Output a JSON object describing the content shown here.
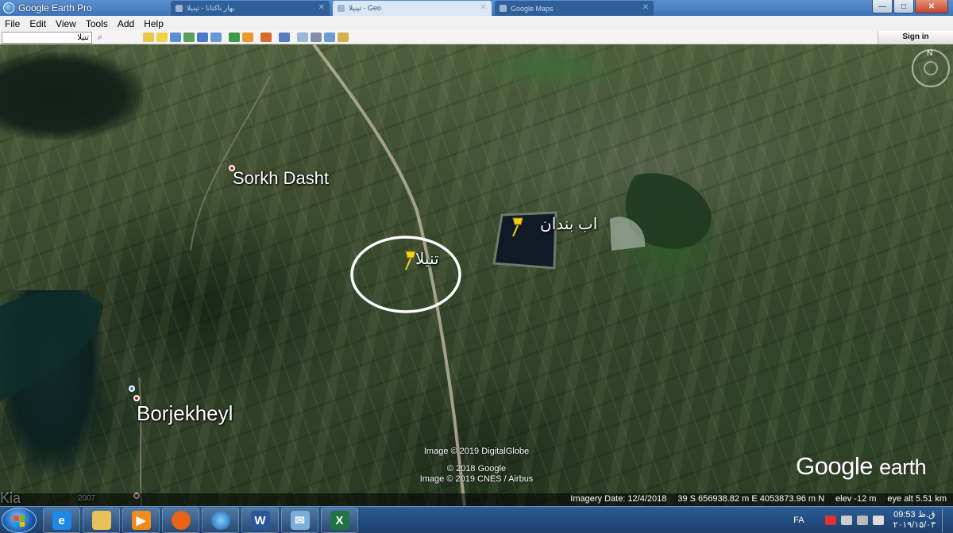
{
  "window": {
    "title": "Google Earth Pro",
    "tabs": [
      "بهار ناکتانا - تینیلا",
      "تینیلا - Geo",
      "Google Maps"
    ],
    "controls": {
      "minimize": "—",
      "maximize": "□",
      "close": "✕"
    }
  },
  "menu": {
    "items": [
      "File",
      "Edit",
      "View",
      "Tools",
      "Add",
      "Help"
    ]
  },
  "toolbar": {
    "search_value": "تنیلا",
    "sign_in_label": "Sign in",
    "icons": [
      "hide-sidebar-icon",
      "add-placemark-icon",
      "add-polygon-icon",
      "add-path-icon",
      "add-image-overlay-icon",
      "record-tour-icon",
      "historical-imagery-icon",
      "sunlight-icon",
      "switch-planet-icon",
      "ruler-icon",
      "email-icon",
      "print-icon",
      "save-image-icon",
      "view-in-maps-icon"
    ]
  },
  "map": {
    "labels": {
      "sorkh_dasht": "Sorkh Dasht",
      "borjekheyl": "Borjekheyl",
      "ab_bandan": "اب بندان",
      "tenela": "تنیلا",
      "year": "2007",
      "partial": "Kia"
    },
    "credits": [
      "Image © 2019 DigitalGlobe",
      "© 2018 Google",
      "Image © 2019 CNES / Airbus"
    ],
    "logo": {
      "google": "Google",
      "earth": "earth"
    },
    "compass_north": "N",
    "status": {
      "imagery_date": "Imagery Date: 12/4/2018",
      "coordinates": "39 S 656938.82 m E 4053873.96 m N",
      "elevation": "elev   -12 m",
      "eye_alt": "eye alt   5.51 km"
    }
  },
  "taskbar": {
    "apps": [
      "windows-media-player-icon",
      "internet-explorer-icon",
      "file-explorer-icon",
      "media-player-icon",
      "firefox-icon",
      "google-earth-icon",
      "word-icon",
      "outlook-icon",
      "excel-icon"
    ],
    "language": "FA",
    "clock_time": "09:53 ق.ظ",
    "clock_date": "۲۰۱۹/۱۵/۰۳"
  },
  "colors": {
    "titlebar": "#3f74b8",
    "pushpin": "#f2d21a",
    "callout_circle": "#ffffff",
    "taskbar": "#1d3f6b"
  }
}
